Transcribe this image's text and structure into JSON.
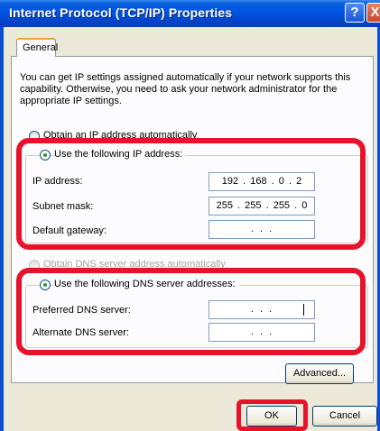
{
  "window": {
    "title": "Internet Protocol (TCP/IP) Properties",
    "help_glyph": "?",
    "close_glyph": "X"
  },
  "tabs": [
    {
      "label": "General"
    }
  ],
  "description": "You can get IP settings assigned automatically if your network supports this capability. Otherwise, you need to ask your network administrator for the appropriate IP settings.",
  "ip_options": {
    "auto_label": "Obtain an IP address automatically",
    "manual_label": "Use the following IP address:",
    "selected": "manual"
  },
  "ip_fields": [
    {
      "label": "IP address:",
      "value": "192 . 168 .  0  .  2"
    },
    {
      "label": "Subnet mask:",
      "value": "255 . 255 . 255 .  0"
    },
    {
      "label": "Default gateway:",
      "value": ""
    }
  ],
  "dns_options": {
    "auto_label": "Obtain DNS server address automatically",
    "manual_label": "Use the following DNS server addresses:",
    "selected": "manual"
  },
  "dns_fields": [
    {
      "label": "Preferred DNS server:",
      "value": ""
    },
    {
      "label": "Alternate DNS server:",
      "value": ""
    }
  ],
  "empty_field_dots": ".      .      .",
  "buttons": {
    "advanced": "Advanced...",
    "ok": "OK",
    "cancel": "Cancel"
  },
  "colors": {
    "highlight": "#e8132a",
    "title_bar": "#0055e5",
    "dialog_bg": "#ece9d8"
  }
}
